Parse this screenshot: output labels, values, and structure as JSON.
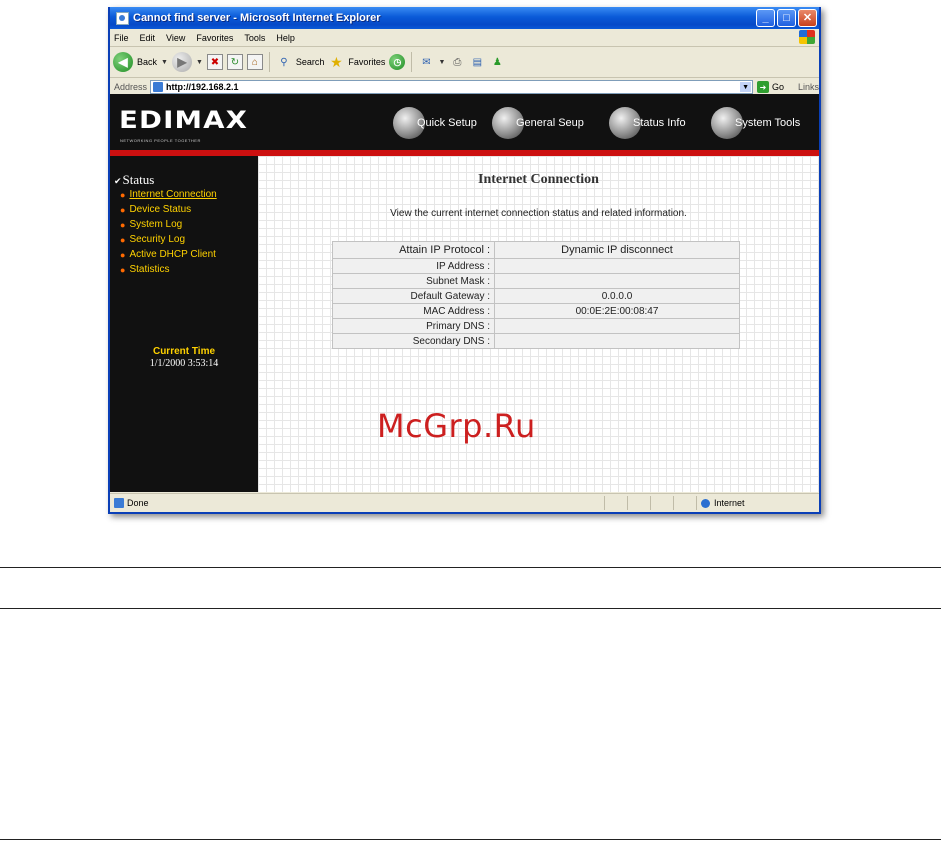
{
  "window": {
    "title": "Cannot find server - Microsoft Internet Explorer",
    "buttons": {
      "minimize": "_",
      "maximize": "□",
      "close": "✕"
    }
  },
  "menu": [
    "File",
    "Edit",
    "View",
    "Favorites",
    "Tools",
    "Help"
  ],
  "toolbar": {
    "back": "Back",
    "search": "Search",
    "favorites": "Favorites"
  },
  "address": {
    "label": "Address",
    "url": "http://192.168.2.1",
    "go": "Go",
    "links": "Links"
  },
  "banner": {
    "logo": "EDIMAX",
    "logo_sub": "NETWORKING PEOPLE TOGETHER",
    "nav": [
      "Quick Setup",
      "General Seup",
      "Status Info",
      "System Tools"
    ]
  },
  "sidebar": {
    "heading": "Status",
    "items": [
      "Internet Connection",
      "Device Status",
      "System Log",
      "Security Log",
      "Active DHCP Client",
      "Statistics"
    ],
    "time_label": "Current Time",
    "time_value": "1/1/2000 3:53:14"
  },
  "main": {
    "title": "Internet Connection",
    "intro": "View the current internet connection status and related information.",
    "rows": [
      {
        "label": "Attain IP Protocol :",
        "value": "Dynamic IP disconnect"
      },
      {
        "label": "IP Address :",
        "value": ""
      },
      {
        "label": "Subnet Mask :",
        "value": ""
      },
      {
        "label": "Default Gateway :",
        "value": "0.0.0.0"
      },
      {
        "label": "MAC Address :",
        "value": "00:0E:2E:00:08:47"
      },
      {
        "label": "Primary DNS :",
        "value": ""
      },
      {
        "label": "Secondary DNS :",
        "value": ""
      }
    ]
  },
  "status": {
    "text": "Done",
    "zone": "Internet"
  },
  "watermark": "McGrp.Ru",
  "colors": {
    "title_bar": "#0a5ad8",
    "banner": "#111111",
    "accent_red": "#cc1010",
    "link_yellow": "#ffd200"
  }
}
